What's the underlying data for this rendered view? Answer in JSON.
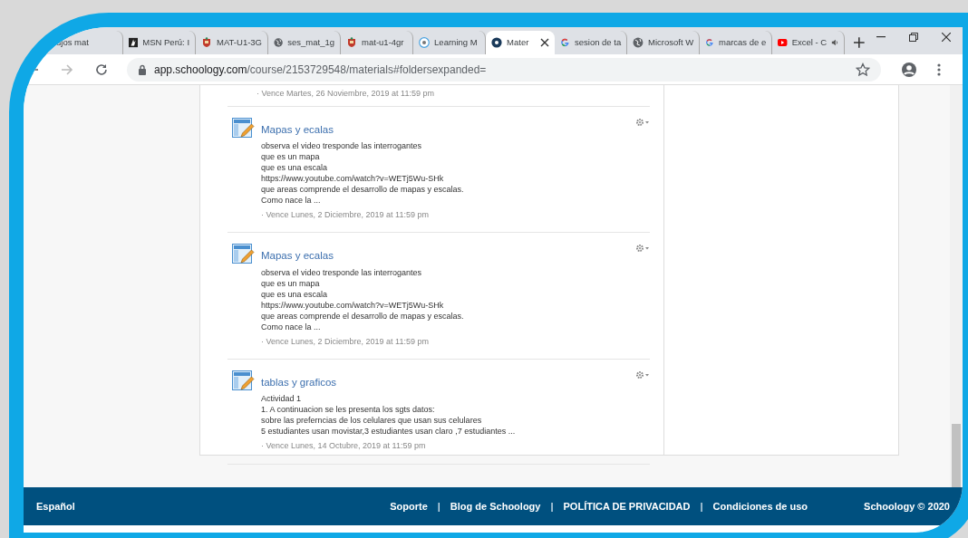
{
  "browser": {
    "tabs": [
      {
        "title": "ujos mat",
        "kind": "plain",
        "selected": false
      },
      {
        "title": "MSN Perú: I",
        "kind": "msn",
        "selected": false
      },
      {
        "title": "MAT-U1-3G",
        "kind": "crest",
        "selected": false
      },
      {
        "title": "ses_mat_1g",
        "kind": "globe",
        "selected": false
      },
      {
        "title": "mat-u1-4gr",
        "kind": "crest",
        "selected": false
      },
      {
        "title": "Learning M",
        "kind": "circle",
        "selected": false
      },
      {
        "title": "Mater",
        "kind": "disc",
        "selected": true
      },
      {
        "title": "sesion de ta",
        "kind": "google",
        "selected": false
      },
      {
        "title": "Microsoft W",
        "kind": "globe",
        "selected": false
      },
      {
        "title": "marcas de e",
        "kind": "google",
        "selected": false
      },
      {
        "title": "Excel - C",
        "kind": "video",
        "selected": false,
        "audio": true
      }
    ],
    "address": {
      "domain": "app.schoology.com",
      "path": "/course/2153729548/materials#foldersexpanded="
    }
  },
  "materials": {
    "top_due": "· Vence Martes, 26 Noviembre, 2019 at 11:59 pm",
    "items": [
      {
        "title": "Mapas y ecalas",
        "lines": [
          "observa el video tresponde las interrogantes",
          "que es un mapa",
          "que es una escala",
          "https://www.youtube.com/watch?v=WETj5Wu-SHk",
          "que areas comprende el desarrollo de mapas y escalas.",
          "Como nace la ..."
        ],
        "due": "· Vence Lunes, 2 Diciembre, 2019 at 11:59 pm"
      },
      {
        "title": "Mapas y ecalas",
        "lines": [
          "observa el video tresponde las interrogantes",
          "que es un mapa",
          "que es una escala",
          "https://www.youtube.com/watch?v=WETj5Wu-SHk",
          "que areas comprende el desarrollo de mapas y escalas.",
          "Como nace la ..."
        ],
        "due": "· Vence Lunes, 2 Diciembre, 2019 at 11:59 pm"
      },
      {
        "title": "tablas y graficos",
        "lines": [
          "Actividad 1",
          "1. A continuacion se les presenta los sgts datos:",
          "sobre las preferncias de los celulares que usan sus celulares",
          "5 estudiantes usan movistar,3 estudiantes usan claro ,7 estudiantes ..."
        ],
        "due": "· Vence Lunes, 14 Octubre, 2019 at 11:59 pm"
      }
    ]
  },
  "footer": {
    "language": "Español",
    "links": [
      {
        "kind": "link",
        "text": "Soporte"
      },
      {
        "kind": "separator",
        "text": "|"
      },
      {
        "kind": "link",
        "text": "Blog de Schoology"
      },
      {
        "kind": "separator",
        "text": "|"
      },
      {
        "kind": "link",
        "text": "POLÍTICA DE PRIVACIDAD"
      },
      {
        "kind": "separator",
        "text": "|"
      },
      {
        "kind": "link",
        "text": "Condiciones de uso"
      }
    ],
    "copyright": "Schoology © 2020"
  }
}
